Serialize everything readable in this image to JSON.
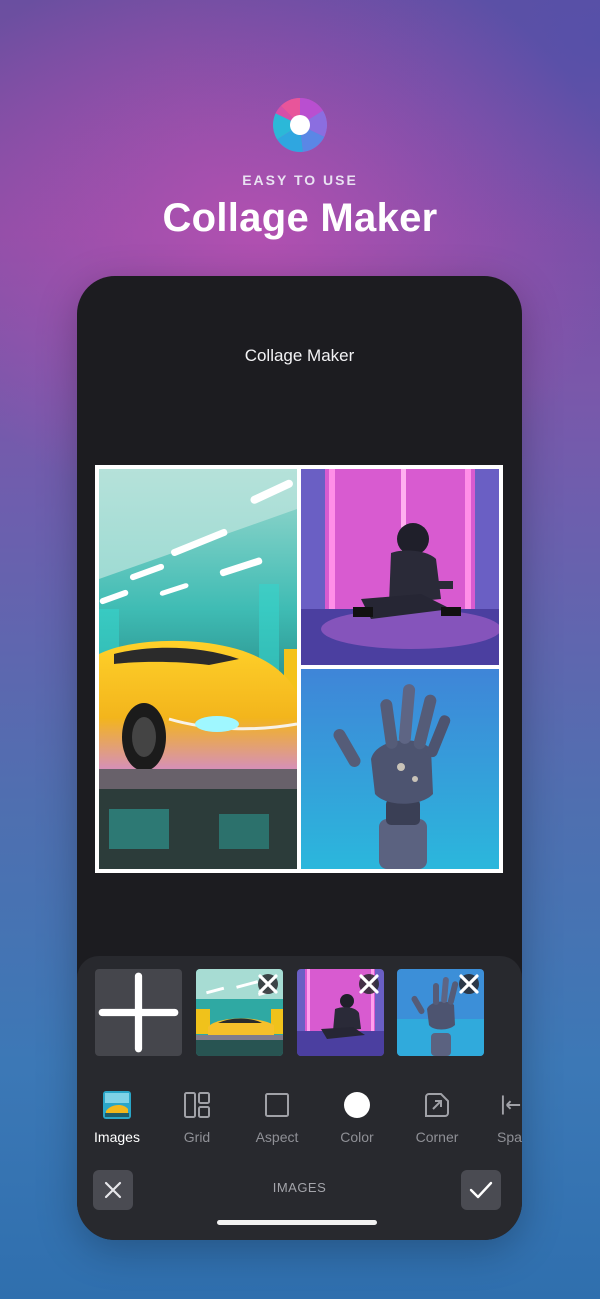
{
  "promo": {
    "eyebrow": "EASY TO USE",
    "headline": "Collage Maker",
    "logo_icon": "aperture-logo-icon"
  },
  "screen": {
    "title": "Collage Maker",
    "collage": {
      "layout": "one-left-two-right",
      "border_color": "#ffffff",
      "images": [
        "yellow-sports-car-photo",
        "neon-hooded-person-photo",
        "robot-hand-photo"
      ]
    },
    "images_tray": {
      "add_icon": "plus-icon",
      "thumbnails": [
        {
          "image": "yellow-sports-car-photo",
          "remove_icon": "close-icon"
        },
        {
          "image": "neon-hooded-person-photo",
          "remove_icon": "close-icon"
        },
        {
          "image": "robot-hand-photo",
          "remove_icon": "close-icon"
        }
      ]
    },
    "toolbar": {
      "images": "Images",
      "grid": "Grid",
      "aspect": "Aspect",
      "color": "Color",
      "corner": "Corner",
      "spacing": "Spa"
    },
    "bottom_bar": {
      "mode_label": "IMAGES",
      "cancel_icon": "close-icon",
      "confirm_icon": "checkmark-icon"
    },
    "colors": {
      "panel": "#28292e",
      "screen": "#1c1c20",
      "accent": "#ffffff"
    }
  }
}
